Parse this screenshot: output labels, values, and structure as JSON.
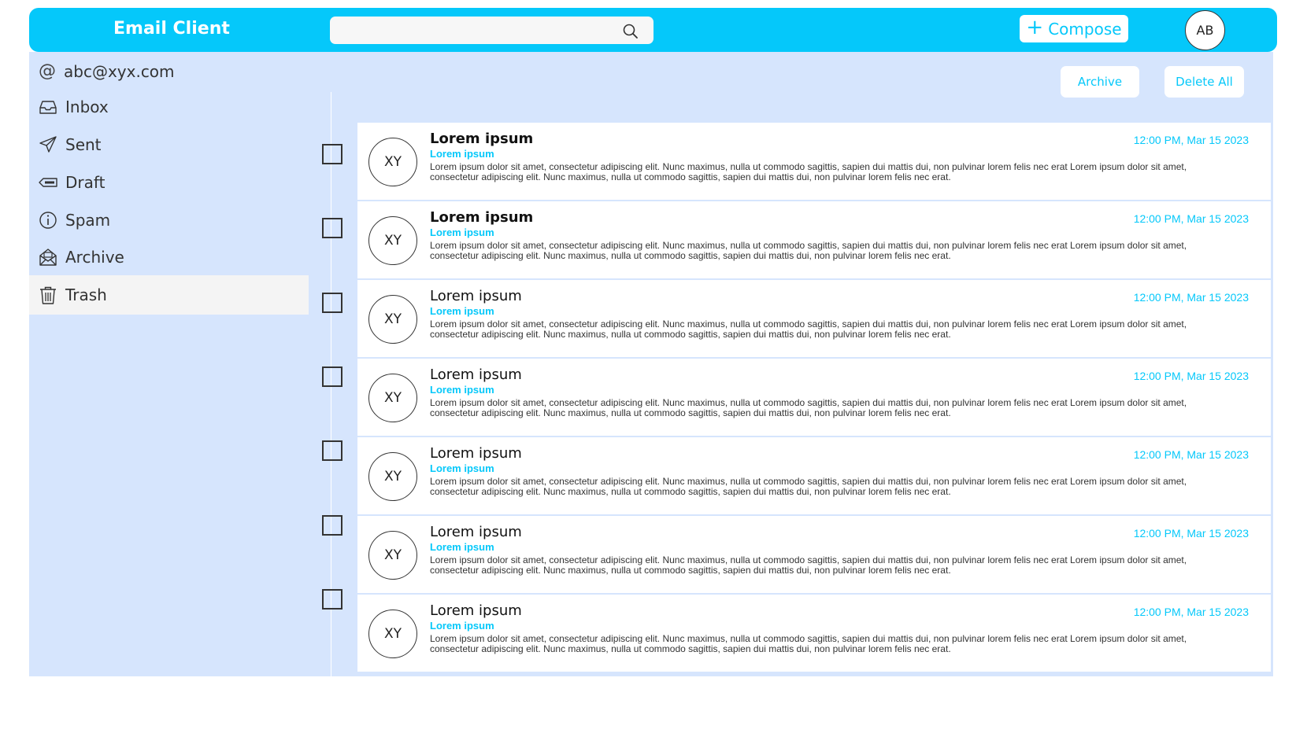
{
  "app": {
    "title": "Email Client",
    "colors": {
      "accent": "#05c8fa",
      "panel": "#d6e5fd",
      "active": "#f4f4f4"
    }
  },
  "header": {
    "search_placeholder": "",
    "search_icon": "search-icon",
    "compose_plus": "+",
    "compose_label": "Compose",
    "avatar_initials": "AB"
  },
  "sidebar": {
    "account": "abc@xyx.com",
    "account_symbol": "@",
    "items": [
      {
        "label": "Inbox",
        "icon": "inbox-icon"
      },
      {
        "label": "Sent",
        "icon": "send-icon"
      },
      {
        "label": "Draft",
        "icon": "draft-icon"
      },
      {
        "label": "Spam",
        "icon": "info-icon"
      },
      {
        "label": "Archive",
        "icon": "archive-icon"
      },
      {
        "label": "Trash",
        "icon": "trash-icon",
        "active": true
      }
    ]
  },
  "actions": {
    "archive": "Archive",
    "delete_all": "Delete All"
  },
  "emails": [
    {
      "initials": "XY",
      "subject": "Lorem ipsum",
      "unread": true,
      "sender": "Lorem ipsum",
      "time": "12:00 PM, Mar 15 2023",
      "preview": "Lorem ipsum dolor sit amet, consectetur adipiscing elit. Nunc maximus, nulla ut commodo sagittis, sapien dui mattis dui, non pulvinar lorem felis nec erat Lorem ipsum dolor sit amet, consectetur adipiscing elit. Nunc maximus, nulla ut commodo sagittis, sapien dui mattis dui, non pulvinar lorem felis nec erat."
    },
    {
      "initials": "XY",
      "subject": "Lorem ipsum",
      "unread": true,
      "sender": "Lorem ipsum",
      "time": "12:00 PM, Mar 15 2023",
      "preview": "Lorem ipsum dolor sit amet, consectetur adipiscing elit. Nunc maximus, nulla ut commodo sagittis, sapien dui mattis dui, non pulvinar lorem felis nec erat Lorem ipsum dolor sit amet, consectetur adipiscing elit. Nunc maximus, nulla ut commodo sagittis, sapien dui mattis dui, non pulvinar lorem felis nec erat."
    },
    {
      "initials": "XY",
      "subject": "Lorem ipsum",
      "unread": false,
      "sender": "Lorem ipsum",
      "time": "12:00 PM, Mar 15 2023",
      "preview": "Lorem ipsum dolor sit amet, consectetur adipiscing elit. Nunc maximus, nulla ut commodo sagittis, sapien dui mattis dui, non pulvinar lorem felis nec erat Lorem ipsum dolor sit amet, consectetur adipiscing elit. Nunc maximus, nulla ut commodo sagittis, sapien dui mattis dui, non pulvinar lorem felis nec erat."
    },
    {
      "initials": "XY",
      "subject": "Lorem ipsum",
      "unread": false,
      "sender": "Lorem ipsum",
      "time": "12:00 PM, Mar 15 2023",
      "preview": "Lorem ipsum dolor sit amet, consectetur adipiscing elit. Nunc maximus, nulla ut commodo sagittis, sapien dui mattis dui, non pulvinar lorem felis nec erat Lorem ipsum dolor sit amet, consectetur adipiscing elit. Nunc maximus, nulla ut commodo sagittis, sapien dui mattis dui, non pulvinar lorem felis nec erat."
    },
    {
      "initials": "XY",
      "subject": "Lorem ipsum",
      "unread": false,
      "sender": "Lorem ipsum",
      "time": "12:00 PM, Mar 15 2023",
      "preview": "Lorem ipsum dolor sit amet, consectetur adipiscing elit. Nunc maximus, nulla ut commodo sagittis, sapien dui mattis dui, non pulvinar lorem felis nec erat Lorem ipsum dolor sit amet, consectetur adipiscing elit. Nunc maximus, nulla ut commodo sagittis, sapien dui mattis dui, non pulvinar lorem felis nec erat."
    },
    {
      "initials": "XY",
      "subject": "Lorem ipsum",
      "unread": false,
      "sender": "Lorem ipsum",
      "time": "12:00 PM, Mar 15 2023",
      "preview": "Lorem ipsum dolor sit amet, consectetur adipiscing elit. Nunc maximus, nulla ut commodo sagittis, sapien dui mattis dui, non pulvinar lorem felis nec erat Lorem ipsum dolor sit amet, consectetur adipiscing elit. Nunc maximus, nulla ut commodo sagittis, sapien dui mattis dui, non pulvinar lorem felis nec erat."
    },
    {
      "initials": "XY",
      "subject": "Lorem ipsum",
      "unread": false,
      "sender": "Lorem ipsum",
      "time": "12:00 PM, Mar 15 2023",
      "preview": "Lorem ipsum dolor sit amet, consectetur adipiscing elit. Nunc maximus, nulla ut commodo sagittis, sapien dui mattis dui, non pulvinar lorem felis nec erat Lorem ipsum dolor sit amet, consectetur adipiscing elit. Nunc maximus, nulla ut commodo sagittis, sapien dui mattis dui, non pulvinar lorem felis nec erat."
    }
  ]
}
